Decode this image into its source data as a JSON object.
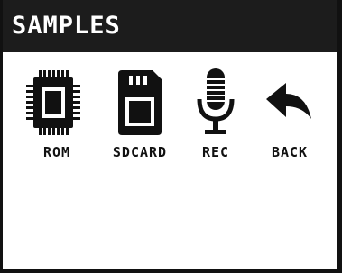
{
  "header": {
    "title": "SAMPLES"
  },
  "menu": {
    "items": [
      {
        "label": "ROM",
        "icon": "chip-icon"
      },
      {
        "label": "SDCARD",
        "icon": "sdcard-icon"
      },
      {
        "label": "REC",
        "icon": "microphone-icon"
      },
      {
        "label": "BACK",
        "icon": "back-arrow-icon"
      }
    ]
  },
  "colors": {
    "titlebar": "#1c1c1c",
    "icon": "#111111",
    "background": "#ffffff"
  }
}
